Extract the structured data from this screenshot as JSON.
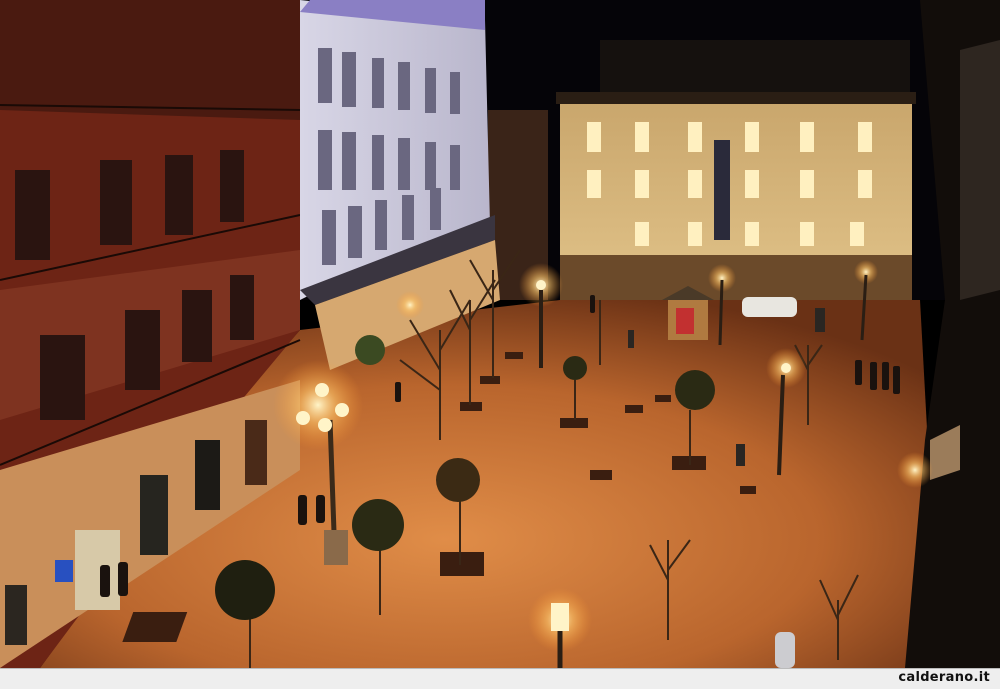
{
  "photo": {
    "subject": "night-city-plaza",
    "colors": {
      "sky": "#050408",
      "pavement": "#c9783a",
      "lamp_glow": "#ffd98a",
      "building_warm": "#d9b57a",
      "building_red": "#7a2a18",
      "white_building": "#e8e6f0"
    }
  },
  "footer": {
    "credit": "calderano.it"
  }
}
